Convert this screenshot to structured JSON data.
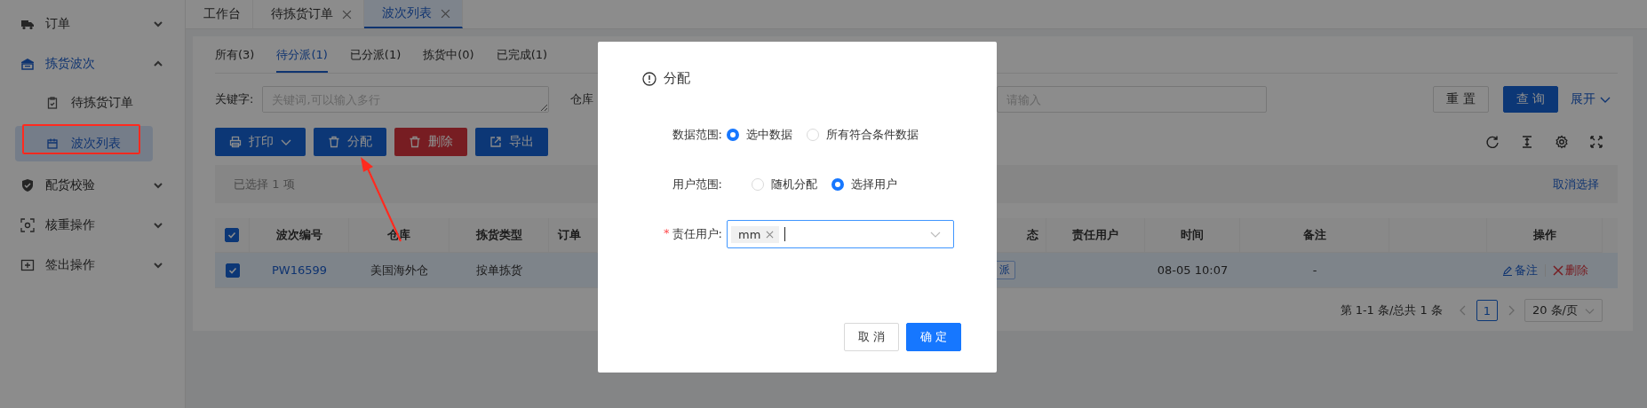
{
  "sidebar": {
    "items": [
      {
        "label": "订单",
        "expanded": false,
        "selected": false
      },
      {
        "label": "拣货波次",
        "expanded": true,
        "selected": true,
        "children": [
          {
            "label": "待拣货订单",
            "selected": false
          },
          {
            "label": "波次列表",
            "selected": true
          }
        ]
      },
      {
        "label": "配货校验",
        "expanded": false,
        "selected": false
      },
      {
        "label": "核重操作",
        "expanded": false,
        "selected": false
      },
      {
        "label": "签出操作",
        "expanded": false,
        "selected": false
      }
    ]
  },
  "page_tabs": [
    {
      "label": "工作台",
      "closable": false,
      "selected": false
    },
    {
      "label": "待拣货订单",
      "closable": true,
      "selected": false
    },
    {
      "label": "波次列表",
      "closable": true,
      "selected": true
    }
  ],
  "status_tabs": [
    {
      "label": "所有(3)",
      "selected": false
    },
    {
      "label": "待分派(1)",
      "selected": true
    },
    {
      "label": "已分派(1)",
      "selected": false
    },
    {
      "label": "拣货中(0)",
      "selected": false
    },
    {
      "label": "已完成(1)",
      "selected": false
    }
  ],
  "filters": {
    "keyword_label": "关键字:",
    "keyword_placeholder": "关键词,可以输入多行",
    "warehouse_label": "仓库",
    "field_placeholder": "请输入",
    "reset": "重 置",
    "query": "查 询",
    "expand": "展开"
  },
  "toolbar": [
    {
      "label": "打印",
      "kind": "dropdown"
    },
    {
      "label": "分配",
      "kind": "primary"
    },
    {
      "label": "删除",
      "kind": "danger"
    },
    {
      "label": "导出",
      "kind": "primary"
    }
  ],
  "selection": {
    "text": "已选择 1 项",
    "clear": "取消选择"
  },
  "table": {
    "all_checked": true,
    "columns_left": [
      "波次编号",
      "仓库",
      "拣货类型",
      "订单"
    ],
    "columns_right": [
      "态",
      "责任用户",
      "时间",
      "备注"
    ],
    "actions_column": "操作",
    "rows": [
      {
        "checked": true,
        "selected": true,
        "wave_no": "PW16599",
        "warehouse": "美国海外仓",
        "pick_type": "按单拣货",
        "status_tag": "派",
        "time": "08-05 10:07",
        "remark": "-",
        "actions": [
          {
            "label": "备注",
            "kind": "edit"
          },
          {
            "label": "删除",
            "kind": "delete"
          }
        ]
      }
    ]
  },
  "pagination": {
    "summary": "第 1-1 条/总共 1 条",
    "pages": [
      {
        "label": "1",
        "selected": true
      }
    ],
    "page_size": "20 条/页"
  },
  "dialog": {
    "title": "分配",
    "fields": [
      {
        "label": "数据范围:",
        "kind": "radio",
        "options": [
          {
            "label": "选中数据",
            "selected": true
          },
          {
            "label": "所有符合条件数据",
            "selected": false
          }
        ]
      },
      {
        "label": "用户范围:",
        "kind": "radio",
        "options": [
          {
            "label": "随机分配",
            "selected": false
          },
          {
            "label": "选择用户",
            "selected": true
          }
        ]
      },
      {
        "label": "责任用户:",
        "kind": "select",
        "required_mark": "*",
        "tags": [
          "mm"
        ]
      }
    ],
    "buttons": [
      {
        "label": "取 消",
        "kind": "default"
      },
      {
        "label": "确 定",
        "kind": "primary"
      }
    ]
  }
}
